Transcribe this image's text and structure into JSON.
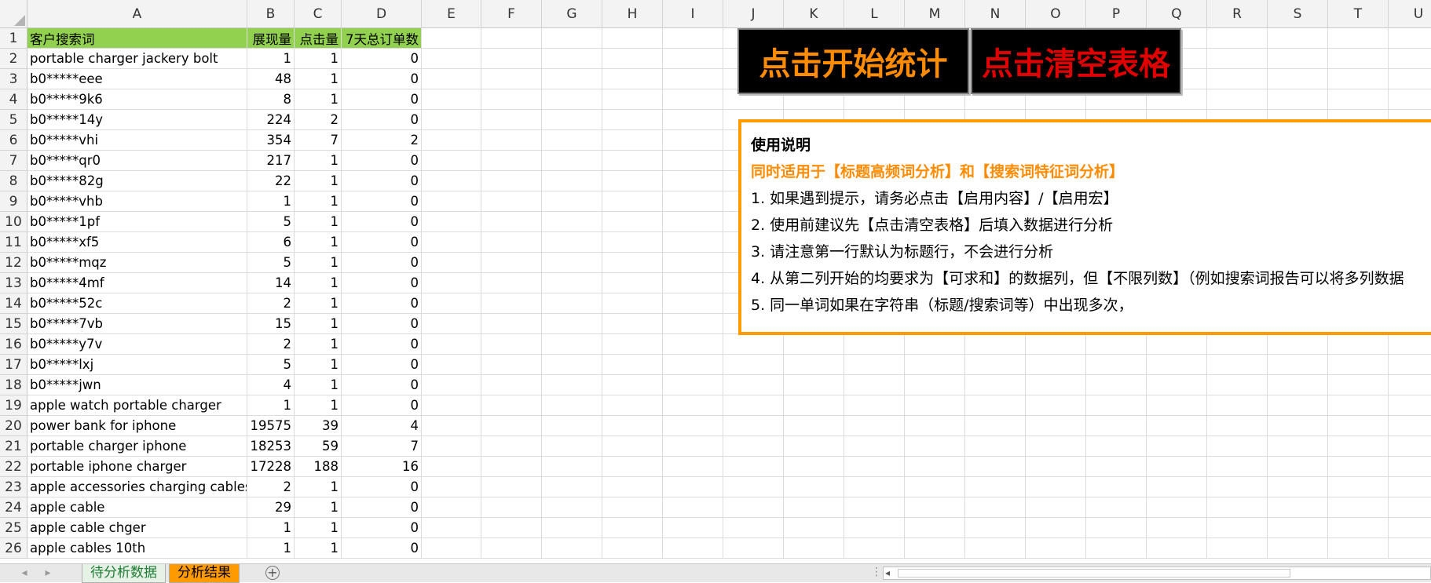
{
  "columns": [
    "A",
    "B",
    "C",
    "D",
    "E",
    "F",
    "G",
    "H",
    "I",
    "J",
    "K",
    "L",
    "M",
    "N",
    "O",
    "P",
    "Q",
    "R",
    "S",
    "T",
    "U"
  ],
  "row_numbers": [
    "1",
    "2",
    "3",
    "4",
    "5",
    "6",
    "7",
    "8",
    "9",
    "10",
    "11",
    "12",
    "13",
    "14",
    "15",
    "16",
    "17",
    "18",
    "19",
    "20",
    "21",
    "22",
    "23",
    "24",
    "25",
    "26"
  ],
  "table": {
    "headers": [
      "客户搜索词",
      "展现量",
      "点击量",
      "7天总订单数"
    ],
    "rows": [
      [
        "portable charger jackery bolt",
        "1",
        "1",
        "0"
      ],
      [
        "b0*****eee",
        "48",
        "1",
        "0"
      ],
      [
        "b0*****9k6",
        "8",
        "1",
        "0"
      ],
      [
        "b0*****14y",
        "224",
        "2",
        "0"
      ],
      [
        "b0*****vhi",
        "354",
        "7",
        "2"
      ],
      [
        "b0*****qr0",
        "217",
        "1",
        "0"
      ],
      [
        "b0*****82g",
        "22",
        "1",
        "0"
      ],
      [
        "b0*****vhb",
        "1",
        "1",
        "0"
      ],
      [
        "b0*****1pf",
        "5",
        "1",
        "0"
      ],
      [
        "b0*****xf5",
        "6",
        "1",
        "0"
      ],
      [
        "b0*****mqz",
        "5",
        "1",
        "0"
      ],
      [
        "b0*****4mf",
        "14",
        "1",
        "0"
      ],
      [
        "b0*****52c",
        "2",
        "1",
        "0"
      ],
      [
        "b0*****7vb",
        "15",
        "1",
        "0"
      ],
      [
        "b0*****y7v",
        "2",
        "1",
        "0"
      ],
      [
        "b0*****lxj",
        "5",
        "1",
        "0"
      ],
      [
        "b0*****jwn",
        "4",
        "1",
        "0"
      ],
      [
        "apple watch portable charger",
        "1",
        "1",
        "0"
      ],
      [
        "power bank for iphone",
        "19575",
        "39",
        "4"
      ],
      [
        "portable charger iphone",
        "18253",
        "59",
        "7"
      ],
      [
        "portable iphone charger",
        "17228",
        "188",
        "16"
      ],
      [
        "apple accessories charging cables",
        "2",
        "1",
        "0"
      ],
      [
        "apple cable",
        "29",
        "1",
        "0"
      ],
      [
        "apple cable chger",
        "1",
        "1",
        "0"
      ],
      [
        "apple cables 10th",
        "1",
        "1",
        "0"
      ]
    ]
  },
  "buttons": {
    "start": "点击开始统计",
    "clear": "点击清空表格"
  },
  "instructions": {
    "title": "使用说明",
    "subtitle": "同时适用于【标题高频词分析】和【搜索词特征词分析】",
    "items": [
      "1. 如果遇到提示，请务必点击【启用内容】/【启用宏】",
      "2. 使用前建议先【点击清空表格】后填入数据进行分析",
      "3. 请注意第一行默认为标题行，不会进行分析",
      "4. 从第二列开始的均要求为【可求和】的数据列，但【不限列数】（例如搜索词报告可以将多列数据",
      "5. 同一单词如果在字符串（标题/搜索词等）中出现多次，"
    ]
  },
  "sheet_tabs": [
    "待分析数据",
    "分析结果"
  ],
  "active_tab": "分析结果",
  "colors": {
    "header_fill": "#92d050",
    "start_text": "#ff8c00",
    "clear_text": "#e00000",
    "instruction_border": "#ff9a00",
    "active_tab": "#ff9a00"
  },
  "icons": [
    "corner-select-icon",
    "nav-first-icon",
    "nav-prev-icon",
    "add-sheet-icon",
    "scroll-left-icon"
  ]
}
